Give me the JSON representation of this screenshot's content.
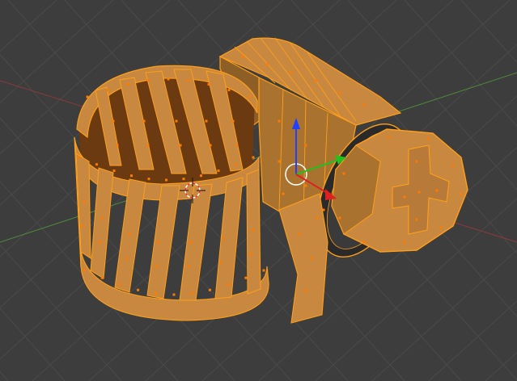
{
  "viewport": {
    "background": "#3d3d3d",
    "grid_color": "#4a4a4a",
    "axis_x_color": "#8a3a3a",
    "axis_y_color": "#4e8a3a"
  },
  "mesh": {
    "edge_color": "#ff9f1a",
    "face_color": "#c8883f",
    "face_shadow_color": "#6b3a10",
    "vertex_color": "#ff7a00"
  },
  "cursor": {
    "icon": "3d-cursor-icon"
  },
  "manipulator": {
    "icon": "transform-manipulator-icon",
    "x_color": "#e02020",
    "y_color": "#20c020",
    "z_color": "#2040ff",
    "center_color": "#ffffff"
  }
}
